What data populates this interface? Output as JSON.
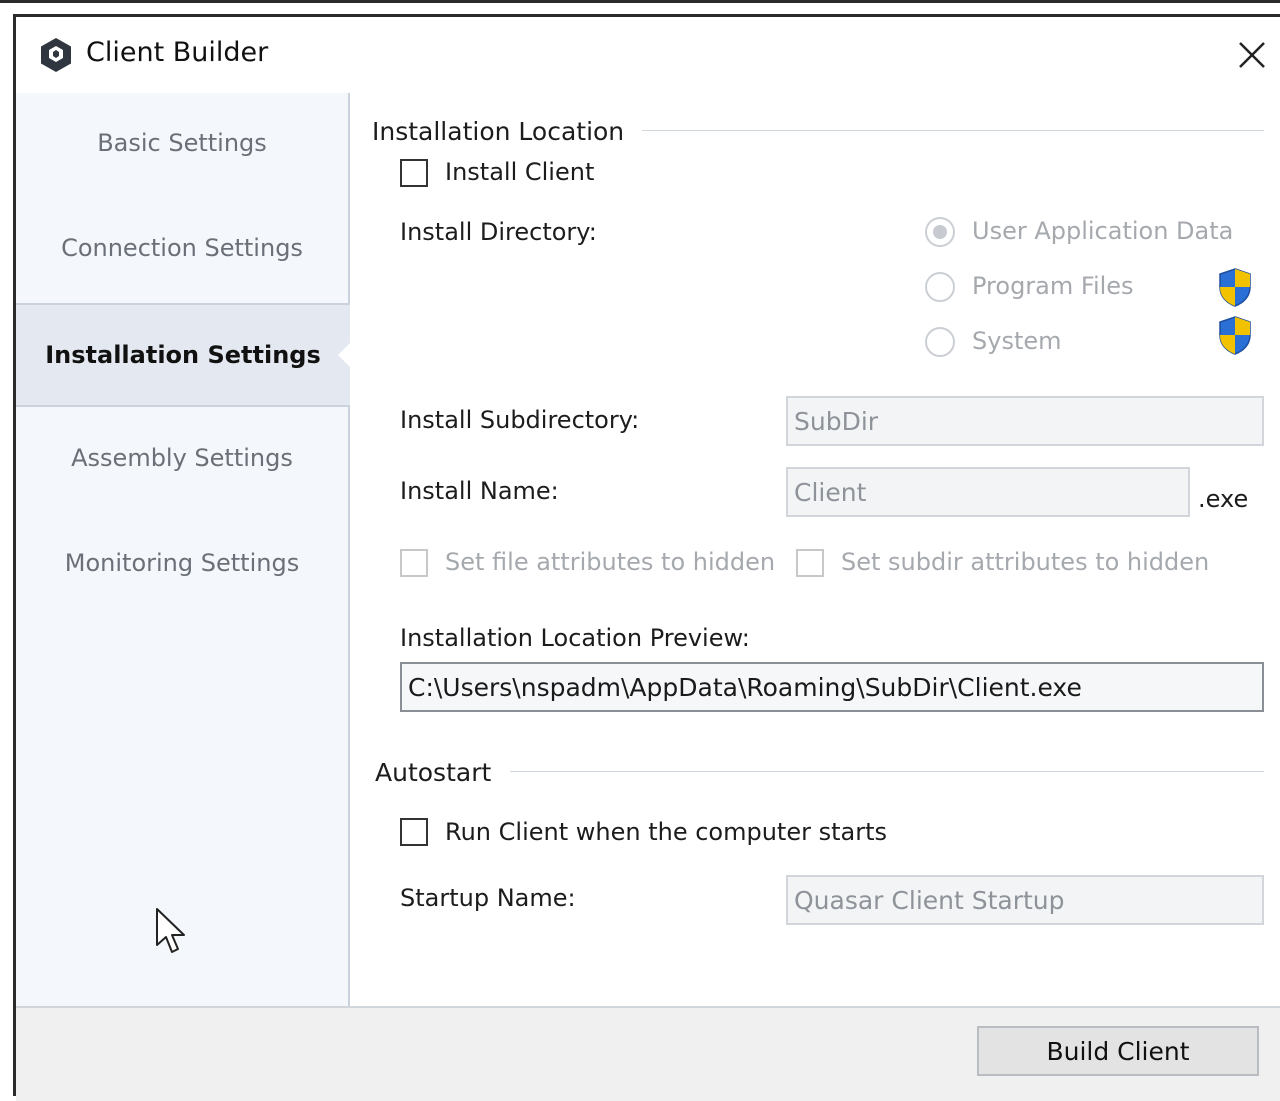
{
  "window": {
    "title": "Client Builder",
    "app_icon": "hexagon-app-icon",
    "close_icon": "close-icon"
  },
  "sidebar": {
    "items": [
      {
        "label": "Basic Settings",
        "active": false
      },
      {
        "label": "Connection Settings",
        "active": false
      },
      {
        "label": "Installation Settings",
        "active": true
      },
      {
        "label": "Assembly Settings",
        "active": false
      },
      {
        "label": "Monitoring Settings",
        "active": false
      }
    ]
  },
  "installation": {
    "group_title": "Installation Location",
    "install_client_label": "Install Client",
    "install_client_checked": false,
    "install_directory_label": "Install Directory:",
    "directory_options": [
      {
        "label": "User Application Data",
        "selected": true,
        "shield": false
      },
      {
        "label": "Program Files",
        "selected": false,
        "shield": true
      },
      {
        "label": "System",
        "selected": false,
        "shield": true
      }
    ],
    "subdirectory_label": "Install Subdirectory:",
    "subdirectory_value": "SubDir",
    "name_label": "Install Name:",
    "name_value": "Client",
    "name_suffix": ".exe",
    "hide_file_label": "Set file attributes to hidden",
    "hide_subdir_label": "Set subdir attributes to hidden",
    "preview_label": "Installation Location Preview:",
    "preview_value": "C:\\Users\\nspadm\\AppData\\Roaming\\SubDir\\Client.exe"
  },
  "autostart": {
    "group_title": "Autostart",
    "run_label": "Run Client when the computer starts",
    "run_checked": false,
    "startup_name_label": "Startup Name:",
    "startup_name_value": "Quasar Client Startup"
  },
  "footer": {
    "build_label": "Build Client"
  },
  "colors": {
    "sidebar_bg": "#f4f7fb",
    "active_nav_bg": "#e4e9f1",
    "footer_bg": "#f0f0f0",
    "shield_blue": "#2a6fd6",
    "shield_yellow": "#f2c200"
  }
}
